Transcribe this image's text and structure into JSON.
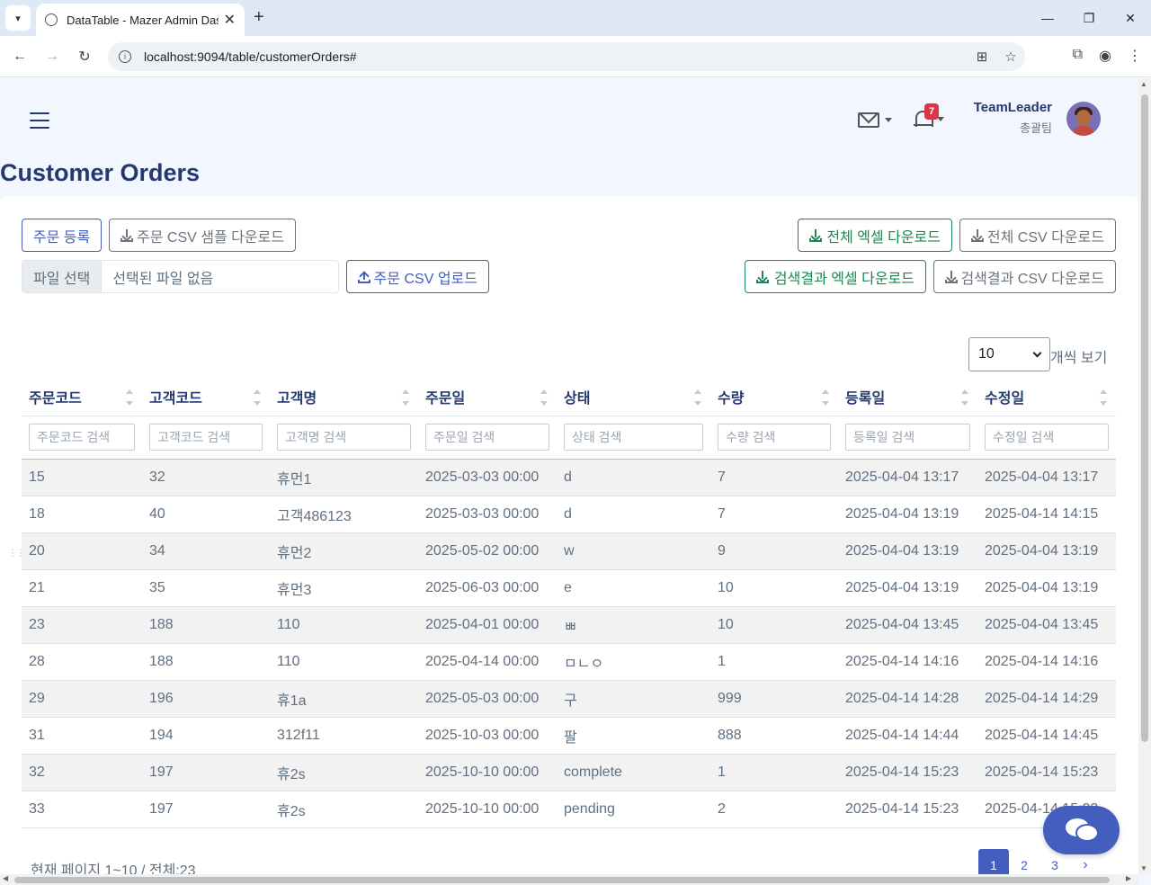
{
  "browser": {
    "tab_title": "DataTable - Mazer Admin Das",
    "url": "localhost:9094/table/customerOrders#"
  },
  "header": {
    "notification_count": "7",
    "user_name": "TeamLeader",
    "user_team": "총괄팀"
  },
  "page_title": "Customer Orders",
  "toolbar": {
    "register_order": "주문 등록",
    "csv_sample_download": "주문 CSV 샘플 다운로드",
    "file_choose": "파일 선택",
    "file_none": "선택된 파일 없음",
    "csv_upload": "주문 CSV 업로드",
    "all_excel_download": "전체 엑셀 다운로드",
    "all_csv_download": "전체 CSV 다운로드",
    "result_excel_download": "검색결과 엑셀 다운로드",
    "result_csv_download": "검색결과 CSV 다운로드"
  },
  "length": {
    "selected": "10",
    "label": "개씩 보기"
  },
  "table": {
    "columns": [
      "주문코드",
      "고객코드",
      "고객명",
      "주문일",
      "상태",
      "수량",
      "등록일",
      "수정일"
    ],
    "filters": [
      "주문코드 검색",
      "고객코드 검색",
      "고객명 검색",
      "주문일 검색",
      "상태 검색",
      "수량 검색",
      "등록일 검색",
      "수정일 검색"
    ],
    "rows": [
      [
        "15",
        "32",
        "휴먼1",
        "2025-03-03 00:00",
        "d",
        "7",
        "2025-04-04 13:17",
        "2025-04-04 13:17"
      ],
      [
        "18",
        "40",
        "고객486123",
        "2025-03-03 00:00",
        "d",
        "7",
        "2025-04-04 13:19",
        "2025-04-14 14:15"
      ],
      [
        "20",
        "34",
        "휴먼2",
        "2025-05-02 00:00",
        "w",
        "9",
        "2025-04-04 13:19",
        "2025-04-04 13:19"
      ],
      [
        "21",
        "35",
        "휴먼3",
        "2025-06-03 00:00",
        "e",
        "10",
        "2025-04-04 13:19",
        "2025-04-04 13:19"
      ],
      [
        "23",
        "188",
        "110",
        "2025-04-01 00:00",
        "ㅃ",
        "10",
        "2025-04-04 13:45",
        "2025-04-04 13:45"
      ],
      [
        "28",
        "188",
        "110",
        "2025-04-14 00:00",
        "ㅁㄴㅇ",
        "1",
        "2025-04-14 14:16",
        "2025-04-14 14:16"
      ],
      [
        "29",
        "196",
        "휴1a",
        "2025-05-03 00:00",
        "구",
        "999",
        "2025-04-14 14:28",
        "2025-04-14 14:29"
      ],
      [
        "31",
        "194",
        "312f11",
        "2025-10-03 00:00",
        "팔",
        "888",
        "2025-04-14 14:44",
        "2025-04-14 14:45"
      ],
      [
        "32",
        "197",
        "휴2s",
        "2025-10-10 00:00",
        "complete",
        "1",
        "2025-04-14 15:23",
        "2025-04-14 15:23"
      ],
      [
        "33",
        "197",
        "휴2s",
        "2025-10-10 00:00",
        "pending",
        "2",
        "2025-04-14 15:23",
        "2025-04-14 15:23"
      ]
    ]
  },
  "footer": {
    "info": "현재 페이지 1~10 / 전체:23",
    "pages": [
      "1",
      "2",
      "3"
    ],
    "next": "›"
  }
}
